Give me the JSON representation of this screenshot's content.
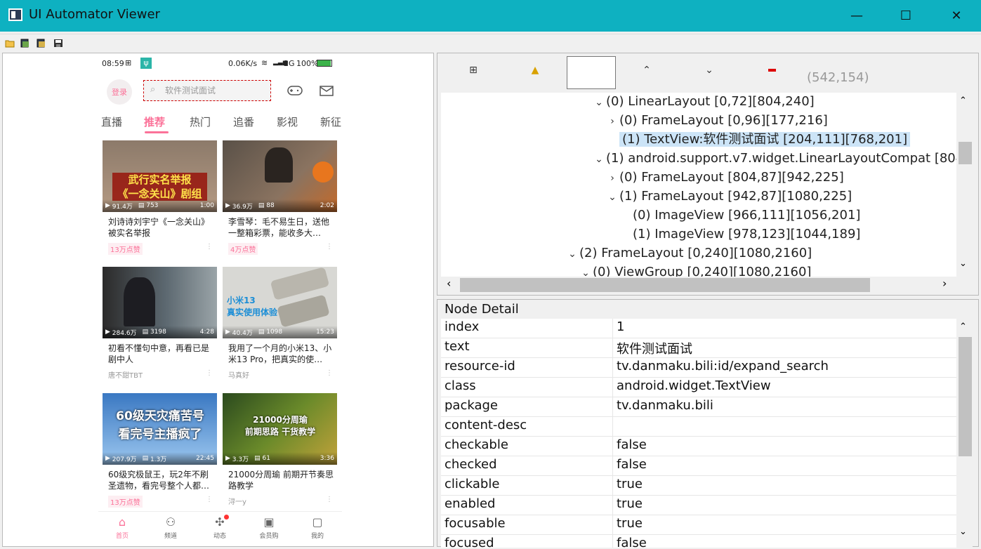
{
  "window": {
    "title": "UI Automator Viewer",
    "minimize_glyph": "—",
    "maximize_glyph": "☐",
    "close_glyph": "✕"
  },
  "toolbar": {
    "icons": [
      "open-folder-icon",
      "device-screenshot-icon",
      "device-screenshot-compressed-icon",
      "save-icon"
    ]
  },
  "phone": {
    "status": {
      "time": "08:59",
      "speed": "0.06K/s",
      "network": "2G",
      "battery": "100%"
    },
    "login_label": "登录",
    "search_placeholder": "软件测试面试",
    "tabs": [
      "直播",
      "推荐",
      "热门",
      "追番",
      "影视",
      "新征"
    ],
    "active_tab": 1,
    "cards": [
      {
        "thumb_text": "武行实名举报\n《一念关山》剧组",
        "views": "91.4万",
        "comments": "753",
        "duration": "1:00",
        "title": "刘诗诗刘宇宁《一念关山》被实名举报",
        "footer": "13万点赞",
        "footer_pink": true
      },
      {
        "thumb_text": "",
        "views": "36.9万",
        "comments": "88",
        "duration": "2:02",
        "title": "李雪琴：毛不易生日，送他一整箱彩票，能收多大…",
        "footer": "4万点赞",
        "footer_pink": true
      },
      {
        "thumb_text": "",
        "views": "284.6万",
        "comments": "3198",
        "duration": "4:28",
        "title": "初看不懂句中意，再看已是剧中人",
        "footer": "唐不甜TBT",
        "footer_pink": false
      },
      {
        "thumb_text": "小米13\n真实使用体验",
        "views": "40.4万",
        "comments": "1098",
        "duration": "15:23",
        "title": "我用了一个月的小米13、小米13 Pro，把真实的使…",
        "footer": "马真好",
        "footer_pink": false
      },
      {
        "thumb_text": "60级天灾痛苦号\n看完号主播疯了",
        "views": "207.9万",
        "comments": "1.3万",
        "duration": "22:45",
        "title": "60级究极鼠王，玩2年不刷圣遗物，看完号整个人都…",
        "footer": "13万点赞",
        "footer_pink": true
      },
      {
        "thumb_text": "21000分周瑜\n前期思路 干货教学",
        "views": "3.3万",
        "comments": "61",
        "duration": "3:36",
        "title": "21000分周瑜 前期开节奏思路教学",
        "footer": "浔一y",
        "footer_pink": false
      }
    ],
    "bottom_nav": [
      {
        "label": "首页",
        "icon": "⌂"
      },
      {
        "label": "频道",
        "icon": "⚇"
      },
      {
        "label": "动态",
        "icon": "✣"
      },
      {
        "label": "会员购",
        "icon": "▣"
      },
      {
        "label": "我的",
        "icon": "▢"
      }
    ]
  },
  "inspector": {
    "tool_icons": [
      "expand-all-icon",
      "warning-icon",
      "toggle-nafs-icon",
      "up-icon",
      "down-icon",
      "collapse-icon"
    ],
    "coords": "(542,154)",
    "tree": [
      {
        "indent": 11,
        "arrow": "⌄",
        "label": "(0) LinearLayout [0,72][804,240]"
      },
      {
        "indent": 12,
        "arrow": "›",
        "label": "(0) FrameLayout [0,96][177,216]"
      },
      {
        "indent": 12,
        "arrow": "",
        "label": "(1) TextView:软件测试面试 [204,111][768,201]",
        "selected": true
      },
      {
        "indent": 11,
        "arrow": "⌄",
        "label": "(1) android.support.v7.widget.LinearLayoutCompat [804,7"
      },
      {
        "indent": 12,
        "arrow": "›",
        "label": "(0) FrameLayout [804,87][942,225]"
      },
      {
        "indent": 12,
        "arrow": "⌄",
        "label": "(1) FrameLayout [942,87][1080,225]"
      },
      {
        "indent": 13,
        "arrow": "",
        "label": "(0) ImageView [966,111][1056,201]"
      },
      {
        "indent": 13,
        "arrow": "",
        "label": "(1) ImageView [978,123][1044,189]"
      },
      {
        "indent": 9,
        "arrow": "⌄",
        "label": "(2) FrameLayout [0,240][1080,2160]"
      },
      {
        "indent": 10,
        "arrow": "⌄",
        "label": "(0) ViewGroup [0,240][1080,2160]"
      }
    ],
    "detail_title": "Node Detail",
    "details": [
      {
        "k": "index",
        "v": "1"
      },
      {
        "k": "text",
        "v": "软件测试面试"
      },
      {
        "k": "resource-id",
        "v": "tv.danmaku.bili:id/expand_search"
      },
      {
        "k": "class",
        "v": "android.widget.TextView"
      },
      {
        "k": "package",
        "v": "tv.danmaku.bili"
      },
      {
        "k": "content-desc",
        "v": ""
      },
      {
        "k": "checkable",
        "v": "false"
      },
      {
        "k": "checked",
        "v": "false"
      },
      {
        "k": "clickable",
        "v": "true"
      },
      {
        "k": "enabled",
        "v": "true"
      },
      {
        "k": "focusable",
        "v": "true"
      },
      {
        "k": "focused",
        "v": "false"
      }
    ]
  }
}
